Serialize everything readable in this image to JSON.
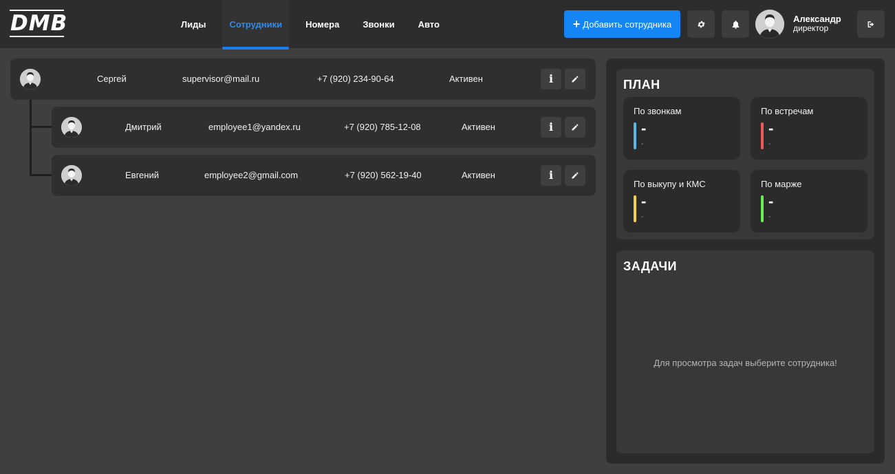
{
  "app": {
    "logo": "DMB"
  },
  "nav": {
    "tabs": [
      {
        "label": "Лиды",
        "active": false
      },
      {
        "label": "Сотрудники",
        "active": true
      },
      {
        "label": "Номера",
        "active": false
      },
      {
        "label": "Звонки",
        "active": false
      },
      {
        "label": "Авто",
        "active": false
      }
    ]
  },
  "header": {
    "add_button_label": "Добавить сотрудника",
    "settings_icon": "gear-icon",
    "notifications_icon": "bell-icon",
    "logout_icon": "sign-out-icon",
    "user": {
      "name": "Александр",
      "role": "директор"
    }
  },
  "employees": [
    {
      "name": "Сергей",
      "email": "supervisor@mail.ru",
      "phone": "+7 (920) 234-90-64",
      "status": "Активен"
    },
    {
      "name": "Дмитрий",
      "email": "employee1@yandex.ru",
      "phone": "+7 (920) 785-12-08",
      "status": "Активен"
    },
    {
      "name": "Евгений",
      "email": "employee2@gmail.com",
      "phone": "+7 (920) 562-19-40",
      "status": "Активен"
    }
  ],
  "plan": {
    "title": "ПЛАН",
    "metrics": [
      {
        "label": "По звонкам",
        "value": "-",
        "sub": "-",
        "color": "#5bb8e6"
      },
      {
        "label": "По встречам",
        "value": "-",
        "sub": "-",
        "color": "#f05a5a"
      },
      {
        "label": "По выкупу и КМС",
        "value": "-",
        "sub": "-",
        "color": "#f0d04a"
      },
      {
        "label": "По марже",
        "value": "-",
        "sub": "-",
        "color": "#6cf05a"
      }
    ]
  },
  "tasks": {
    "title": "ЗАДАЧИ",
    "empty_message": "Для просмотра задач выберите сотрудника!"
  },
  "colors": {
    "accent": "#1585f5",
    "background": "#3f3f3f",
    "header": "#2d2d2d"
  }
}
